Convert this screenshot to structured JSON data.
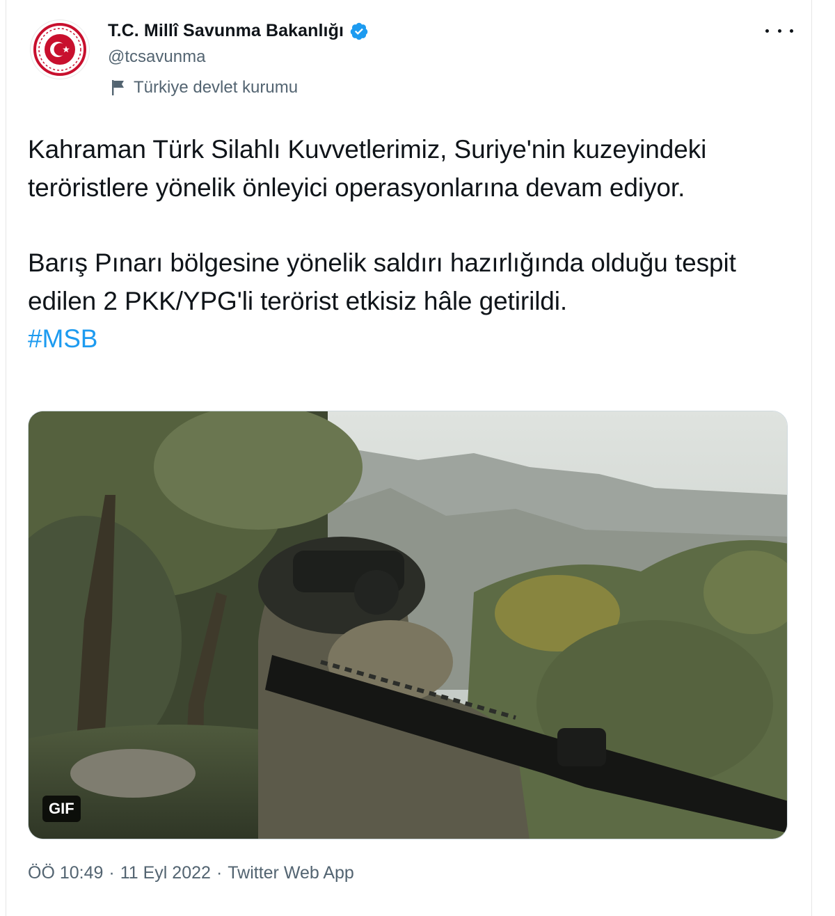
{
  "tweet": {
    "author": {
      "name": "T.C. Millî Savunma Bakanlığı",
      "handle": "@tcsavunma",
      "label": "Türkiye devlet kurumu",
      "verified": true,
      "avatar_icon": "msb-emblem-icon"
    },
    "more_icon": "more-dots-icon",
    "text": {
      "para1": "Kahraman Türk Silahlı Kuvvetlerimiz, Suriye'nin kuzeyindeki teröristlere yönelik önleyici operasyonlarına devam ediyor.",
      "para2": "Barış Pınarı bölgesine yönelik saldırı hazırlığında olduğu tespit edilen 2 PKK/YPG'li terörist etkisiz hâle getirildi.",
      "hashtag": "#MSB"
    },
    "media": {
      "badge": "GIF"
    },
    "meta": {
      "time": "ÖÖ 10:49",
      "separator": "·",
      "date": "11 Eyl 2022",
      "source": "Twitter Web App"
    }
  },
  "colors": {
    "link": "#1d9bf0",
    "secondary_text": "#536471",
    "primary_text": "#0f1419",
    "verified_badge": "#1d9bf0",
    "emblem_red": "#c8102e"
  }
}
